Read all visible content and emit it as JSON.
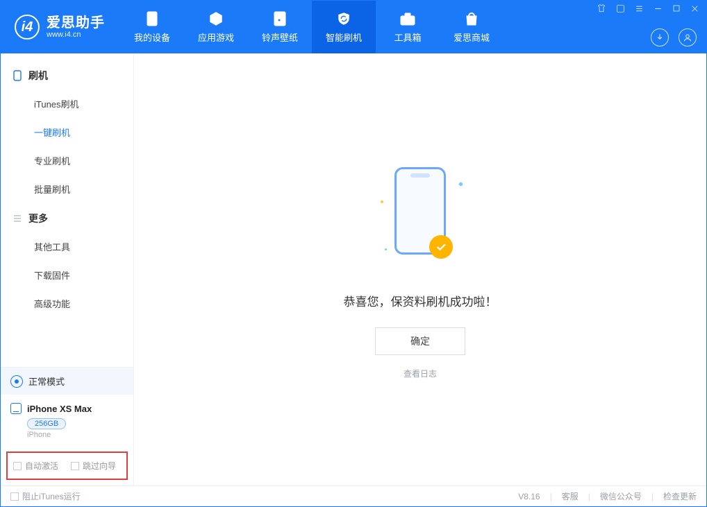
{
  "brand": {
    "name": "爱思助手",
    "url": "www.i4.cn"
  },
  "nav": {
    "items": [
      {
        "label": "我的设备"
      },
      {
        "label": "应用游戏"
      },
      {
        "label": "铃声壁纸"
      },
      {
        "label": "智能刷机"
      },
      {
        "label": "工具箱"
      },
      {
        "label": "爱思商城"
      }
    ]
  },
  "sidebar": {
    "group1": {
      "title": "刷机",
      "items": [
        {
          "label": "iTunes刷机"
        },
        {
          "label": "一键刷机"
        },
        {
          "label": "专业刷机"
        },
        {
          "label": "批量刷机"
        }
      ]
    },
    "group2": {
      "title": "更多",
      "items": [
        {
          "label": "其他工具"
        },
        {
          "label": "下载固件"
        },
        {
          "label": "高级功能"
        }
      ]
    }
  },
  "device": {
    "mode": "正常模式",
    "name": "iPhone XS Max",
    "capacity": "256GB",
    "type": "iPhone"
  },
  "checks": {
    "auto_activate": "自动激活",
    "skip_guide": "跳过向导"
  },
  "result": {
    "title": "恭喜您，保资料刷机成功啦！",
    "ok": "确定",
    "view_log": "查看日志"
  },
  "statusbar": {
    "block_itunes": "阻止iTunes运行",
    "version": "V8.16",
    "links": {
      "support": "客服",
      "wechat": "微信公众号",
      "update": "检查更新"
    }
  }
}
